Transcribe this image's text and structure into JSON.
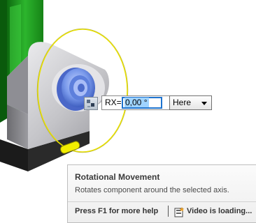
{
  "input": {
    "axis_label": "RX=",
    "value": "0,00 °",
    "reference": "Here"
  },
  "tooltip": {
    "title": "Rotational Movement",
    "description": "Rotates component around the selected axis.",
    "help": "Press F1 for more help",
    "video": "Video is loading..."
  },
  "icons": [
    "rotate-grip-icon",
    "dropdown-arrow-icon",
    "video-icon"
  ],
  "colors": {
    "housing_green": "#1f9a20",
    "part_gray": "#c8c8cc",
    "gear_blue": "#6f90e6",
    "rotation_ring": "#e8e000",
    "input_focus": "#1e73cf"
  }
}
